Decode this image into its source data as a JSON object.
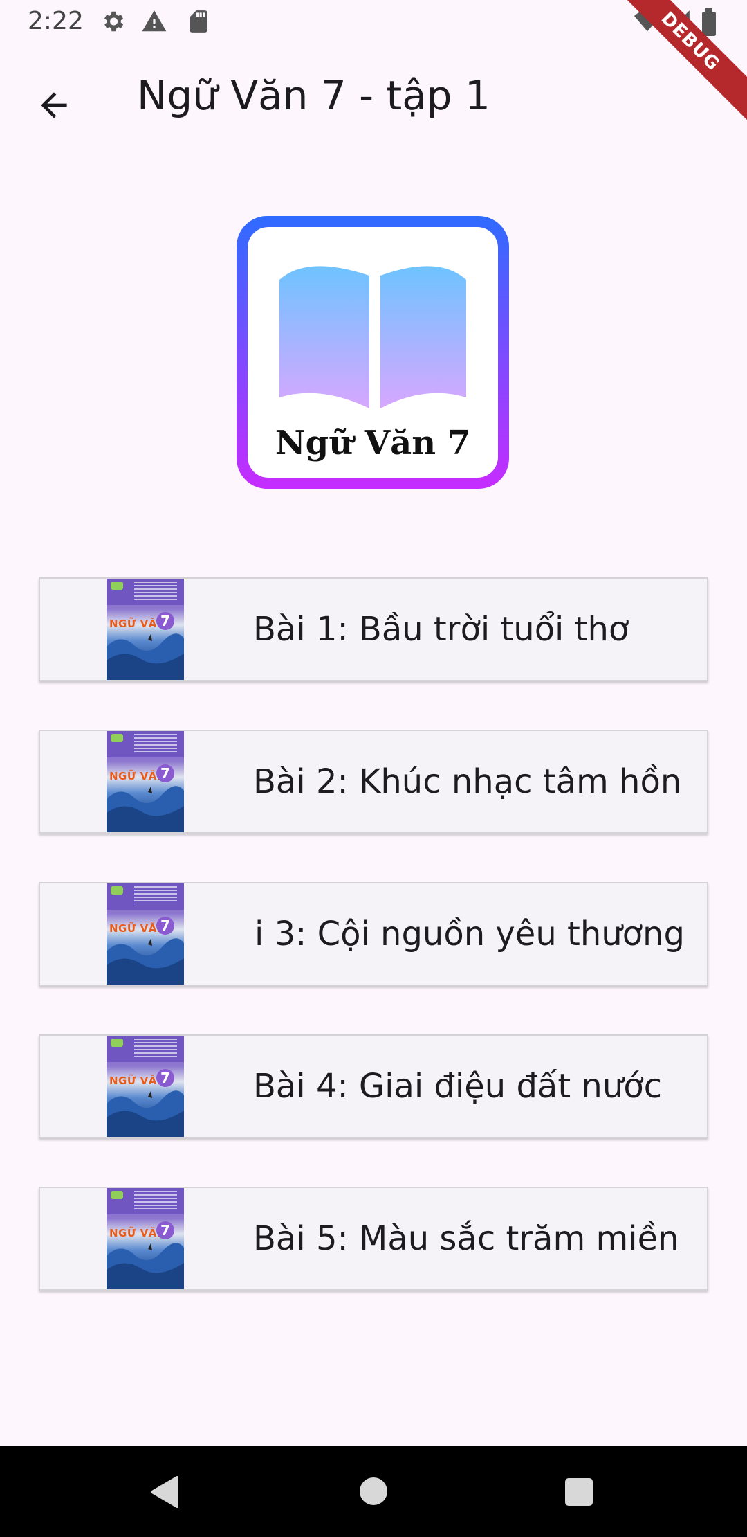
{
  "status_bar": {
    "time": "2:22",
    "icons": [
      "gear-icon",
      "warning-icon",
      "sd-card-icon",
      "wifi-icon",
      "signal-icon",
      "battery-icon"
    ],
    "debug_label": "DEBUG"
  },
  "app_bar": {
    "title": "Ngữ Văn 7 - tập 1",
    "back_icon": "arrow-back-icon"
  },
  "logo": {
    "text": "Ngữ Văn 7",
    "icon": "open-book-icon"
  },
  "lessons": [
    {
      "title": "Bài 1: Bầu trời tuổi thơ",
      "cover_label": "NGỮ VĂN",
      "cover_number": "7"
    },
    {
      "title": "Bài 2: Khúc nhạc tâm hồn",
      "cover_label": "NGỮ VĂN",
      "cover_number": "7"
    },
    {
      "title": "i 3: Cội nguồn yêu thương",
      "cover_label": "NGỮ VĂN",
      "cover_number": "7"
    },
    {
      "title": "Bài 4: Giai điệu đất nước",
      "cover_label": "NGỮ VĂN",
      "cover_number": "7"
    },
    {
      "title": "Bài 5: Màu sắc trăm miền",
      "cover_label": "NGỮ VĂN",
      "cover_number": "7"
    }
  ],
  "nav_bar": {
    "buttons": [
      "nav-back-icon",
      "nav-home-icon",
      "nav-recents-icon"
    ]
  },
  "colors": {
    "background": "#fdf7fd",
    "logo_gradient_top": "#2f6bff",
    "logo_gradient_bottom": "#c62cff",
    "debug_banner": "#b5282c"
  }
}
